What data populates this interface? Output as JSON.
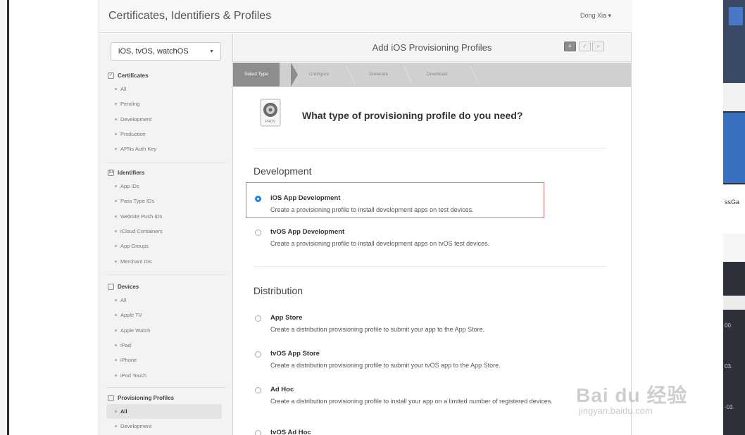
{
  "header": {
    "title": "Certificates, Identifiers & Profiles",
    "user": "Dong Xia ▾"
  },
  "sidebar": {
    "platform": "iOS, tvOS, watchOS",
    "sections": [
      {
        "title": "Certificates",
        "items": [
          "All",
          "Pending",
          "Development",
          "Production",
          "APNs Auth Key"
        ]
      },
      {
        "title": "Identifiers",
        "items": [
          "App IDs",
          "Pass Type IDs",
          "Website Push IDs",
          "iCloud Containers",
          "App Groups",
          "Merchant IDs"
        ]
      },
      {
        "title": "Devices",
        "items": [
          "All",
          "Apple TV",
          "Apple Watch",
          "iPad",
          "iPhone",
          "iPod Touch"
        ]
      },
      {
        "title": "Provisioning Profiles",
        "items": [
          "All",
          "Development"
        ]
      }
    ]
  },
  "content": {
    "title": "Add iOS Provisioning Profiles",
    "steps": [
      "Select Type",
      "Configure",
      "Generate",
      "Download"
    ],
    "icon_label": "PROV",
    "question": "What type of provisioning profile do you need?",
    "development": {
      "title": "Development",
      "options": [
        {
          "name": "iOS App Development",
          "desc": "Create a provisioning profile to install development apps on test devices."
        },
        {
          "name": "tvOS App Development",
          "desc": "Create a provisioning profile to install development apps on tvOS test devices."
        }
      ]
    },
    "distribution": {
      "title": "Distribution",
      "options": [
        {
          "name": "App Store",
          "desc": "Create a distribution provisioning profile to submit your app to the App Store."
        },
        {
          "name": "tvOS App Store",
          "desc": "Create a distribution provisioning profile to submit your tvOS app to the App Store."
        },
        {
          "name": "Ad Hoc",
          "desc": "Create a distribution provisioning profile to install your app on a limited number of registered devices."
        },
        {
          "name": "tvOS Ad Hoc",
          "desc": ""
        }
      ]
    }
  },
  "background_window": {
    "labels": [
      "ssGa",
      "00.",
      "03.",
      "-03."
    ]
  },
  "watermark": {
    "logo": "Bai du 经验",
    "url": "jingyan.baidu.com"
  },
  "colors": {
    "selected_radio": "#2b7fd4",
    "highlight_box": "#e07070",
    "step_active": "#8d8d8d"
  }
}
